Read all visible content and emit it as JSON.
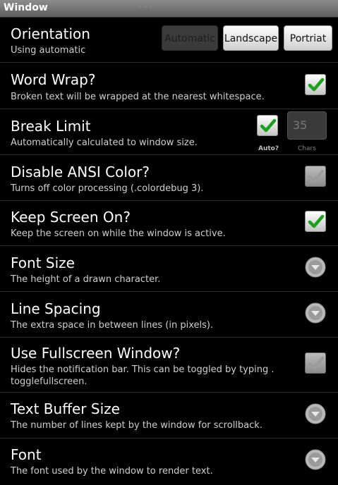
{
  "window_title": "Window",
  "orientation": {
    "title": "Orientation",
    "summary": "Using automatic",
    "buttons": [
      {
        "label": "Automatic",
        "enabled": false
      },
      {
        "label": "Landscape",
        "enabled": true
      },
      {
        "label": "Portriat",
        "enabled": true
      }
    ]
  },
  "word_wrap": {
    "title": "Word Wrap?",
    "summary": "Broken text will be wrapped at the nearest whitespace.",
    "checked": true
  },
  "break_limit": {
    "title": "Break Limit",
    "summary": "Automatically calculated to window size.",
    "auto_checked": true,
    "auto_label": "Auto?",
    "chars_value": "35",
    "chars_label": "Chars"
  },
  "disable_ansi": {
    "title": "Disable ANSI Color?",
    "summary": "Turns off color processing (.colordebug 3).",
    "checked": false,
    "enabled": false
  },
  "keep_screen_on": {
    "title": "Keep Screen On?",
    "summary": "Keep the screen on while the window is active.",
    "checked": true
  },
  "font_size": {
    "title": "Font Size",
    "summary": "The height of a drawn character.",
    "icon": "dropdown-arrow-icon"
  },
  "line_spacing": {
    "title": "Line Spacing",
    "summary": "The extra space in between lines (in pixels).",
    "icon": "dropdown-arrow-icon"
  },
  "fullscreen": {
    "title": "Use Fullscreen Window?",
    "summary_line1": "Hides the notification bar. This can be toggled by typing .",
    "summary_line2": "togglefullscreen.",
    "checked": false,
    "enabled": false
  },
  "text_buffer": {
    "title": "Text Buffer Size",
    "summary": "The number of lines kept by the window for scrollback.",
    "icon": "dropdown-arrow-icon"
  },
  "font": {
    "title": "Font",
    "summary": "The font used by the window to render text.",
    "icon": "dropdown-arrow-icon"
  },
  "colors": {
    "check_green": "#1aa21a",
    "disabled_button": "#3b3b3b",
    "background": "#000000"
  }
}
